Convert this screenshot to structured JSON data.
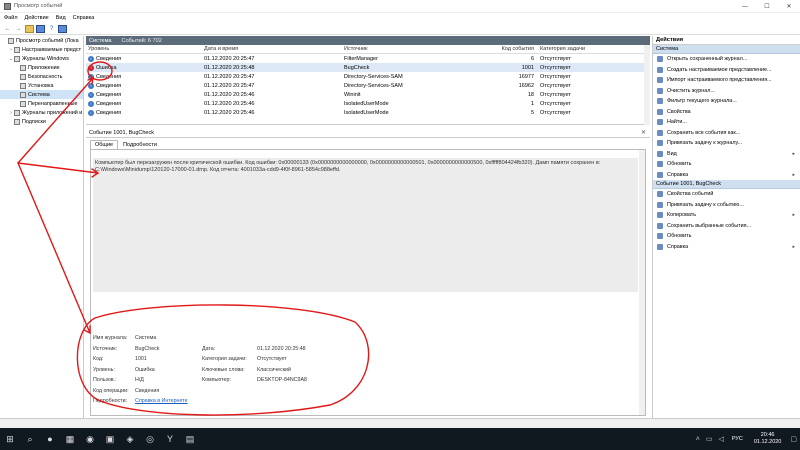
{
  "window": {
    "title": "Просмотр событий",
    "min": "—",
    "max": "☐",
    "close": "✕"
  },
  "menu": [
    "Файл",
    "Действие",
    "Вид",
    "Справка"
  ],
  "toolbar": [
    "←",
    "→",
    "",
    "",
    "?",
    ""
  ],
  "tree": [
    {
      "label": "Просмотр событий (Лока",
      "indent": 0,
      "arrow": ""
    },
    {
      "label": "Настраиваемые предст",
      "indent": 1,
      "arrow": "›"
    },
    {
      "label": "Журналы Windows",
      "indent": 1,
      "arrow": "⌄"
    },
    {
      "label": "Приложение",
      "indent": 2,
      "arrow": ""
    },
    {
      "label": "Безопасность",
      "indent": 2,
      "arrow": ""
    },
    {
      "label": "Установка",
      "indent": 2,
      "arrow": ""
    },
    {
      "label": "Система",
      "indent": 2,
      "arrow": "",
      "selected": true
    },
    {
      "label": "Перенаправленные",
      "indent": 2,
      "arrow": ""
    },
    {
      "label": "Журналы приложений и",
      "indent": 1,
      "arrow": "›"
    },
    {
      "label": "Подписки",
      "indent": 1,
      "arrow": ""
    }
  ],
  "center": {
    "title": "Система",
    "count": "Событий: 6 702"
  },
  "grid": {
    "headers": [
      "Уровень",
      "Дата и время",
      "Источник",
      "Код события",
      "Категория задачи"
    ],
    "rows": [
      {
        "level": "Сведения",
        "type": "info",
        "datetime": "01.12.2020 20:25:47",
        "source": "FilterManager",
        "id": "6",
        "category": "Отсутствует"
      },
      {
        "level": "Ошибка",
        "type": "error",
        "datetime": "01.12.2020 20:25:48",
        "source": "BugCheck",
        "id": "1001",
        "category": "Отсутствует",
        "selected": true
      },
      {
        "level": "Сведения",
        "type": "info",
        "datetime": "01.12.2020 20:25:47",
        "source": "Directory-Services-SAM",
        "id": "16977",
        "category": "Отсутствует"
      },
      {
        "level": "Сведения",
        "type": "info",
        "datetime": "01.12.2020 20:25:47",
        "source": "Directory-Services-SAM",
        "id": "16962",
        "category": "Отсутствует"
      },
      {
        "level": "Сведения",
        "type": "info",
        "datetime": "01.12.2020 20:25:46",
        "source": "Wininit",
        "id": "18",
        "category": "Отсутствует"
      },
      {
        "level": "Сведения",
        "type": "info",
        "datetime": "01.12.2020 20:25:46",
        "source": "IsolatedUserMode",
        "id": "1",
        "category": "Отсутствует"
      },
      {
        "level": "Сведения",
        "type": "info",
        "datetime": "01.12.2020 20:25:46",
        "source": "IsolatedUserMode",
        "id": "5",
        "category": "Отсутствует"
      }
    ]
  },
  "detail": {
    "title": "Событие 1001, BugCheck",
    "close": "✕",
    "tabs": [
      "Общие",
      "Подробности"
    ],
    "description": "Компьютер был перезагружен после критической ошибки. Код ошибки: 0x00000133 (0x0000000000000000, 0x0000000000000501, 0x0000000000000500, 0xfffff804424fb320). Дамп памяти сохранен в: C:\\Windows\\Minidump\\120120-17000-01.dmp. Код отчета: 4001033a-cdd9-4f0f-8961-5854c988effd.",
    "props": {
      "log_label": "Имя журнала:",
      "log_value": "Система",
      "source_label": "Источник:",
      "source_value": "BugCheck",
      "date_label": "Дата:",
      "date_value": "01.12.2020 20:25:48",
      "id_label": "Код:",
      "id_value": "1001",
      "category_label": "Категория задачи:",
      "category_value": "Отсутствует",
      "level_label": "Уровень:",
      "level_value": "Ошибка",
      "keywords_label": "Ключевые слова:",
      "keywords_value": "Классический",
      "user_label": "Пользов.:",
      "user_value": "Н/Д",
      "computer_label": "Компьютер:",
      "computer_value": "DESKTOP-84NC9A8",
      "opcode_label": "Код операции:",
      "opcode_value": "Сведения",
      "more_label": "Подробности:",
      "more_link": "Справка в Интернете"
    }
  },
  "actions": {
    "title": "Действия",
    "section1": "Система",
    "items1": [
      {
        "label": "Открыть сохраненный журнал..."
      },
      {
        "label": "Создать настраиваемое представление..."
      },
      {
        "label": "Импорт настраиваемого представления..."
      },
      {
        "label": "Очистить журнал..."
      },
      {
        "label": "Фильтр текущего журнала..."
      },
      {
        "label": "Свойства"
      },
      {
        "label": "Найти..."
      },
      {
        "label": "Сохранить все события как..."
      },
      {
        "label": "Привязать задачу к журналу..."
      },
      {
        "label": "Вид",
        "sub": "▸"
      },
      {
        "label": "Обновить"
      },
      {
        "label": "Справка",
        "sub": "▸"
      }
    ],
    "section2": "Событие 1001, BugCheck",
    "items2": [
      {
        "label": "Свойства событий"
      },
      {
        "label": "Привязать задачу к событию..."
      },
      {
        "label": "Копировать",
        "sub": "▸"
      },
      {
        "label": "Сохранить выбранные события..."
      },
      {
        "label": "Обновить"
      },
      {
        "label": "Справка",
        "sub": "▸"
      }
    ]
  },
  "taskbar": {
    "icons": [
      "⊞",
      "⌕",
      "●",
      "▦",
      "◉",
      "▣",
      "◈",
      "◎",
      "Y",
      "▤"
    ],
    "lang": "РУС",
    "time": "20:46",
    "date": "01.12.2020"
  },
  "colors": {
    "annotation": "#e01818",
    "header_bg": "#5c6b7a",
    "selected": "#dde8f6"
  }
}
